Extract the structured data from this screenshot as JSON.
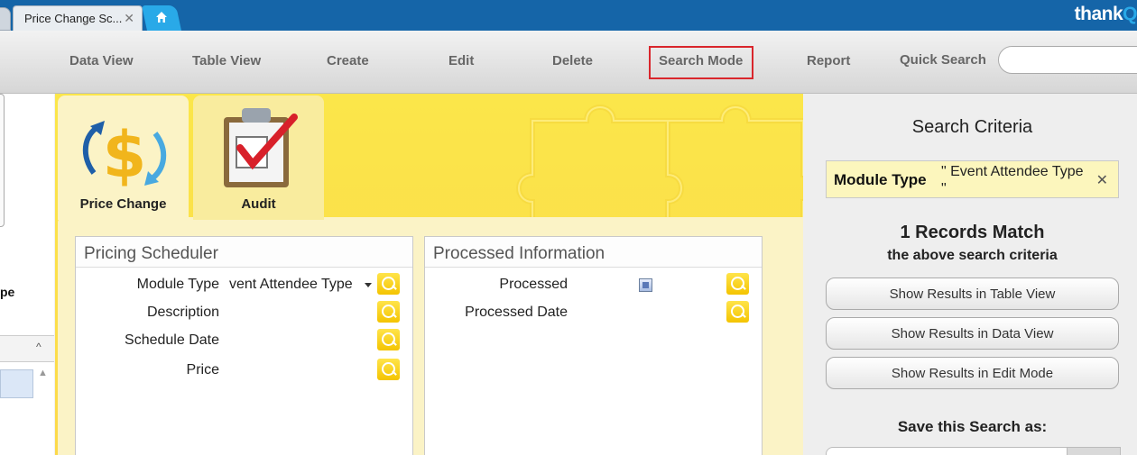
{
  "window": {
    "tab_title": "Price Change Sc...",
    "tab_close": "✕",
    "brand_main": "thank",
    "brand_accent": "Q"
  },
  "toolbar": {
    "data_view": "Data View",
    "table_view": "Table View",
    "create": "Create",
    "edit": "Edit",
    "delete": "Delete",
    "search_mode": "Search Mode",
    "report": "Report",
    "quick_search_label": "Quick Search",
    "quick_search_value": ""
  },
  "left_strip": {
    "partial_text": "pe",
    "up_arrow": "^",
    "up_arrow_small": "▲"
  },
  "icon_tabs": [
    {
      "label": "Price Change"
    },
    {
      "label": "Audit"
    }
  ],
  "pricing_panel": {
    "title": "Pricing Scheduler",
    "fields": [
      {
        "label": "Module Type",
        "value": "vent Attendee Type"
      },
      {
        "label": "Description",
        "value": ""
      },
      {
        "label": "Schedule Date",
        "value": ""
      },
      {
        "label": "Price",
        "value": ""
      }
    ]
  },
  "processed_panel": {
    "title": "Processed Information",
    "fields": [
      {
        "label": "Processed",
        "checked": true
      },
      {
        "label": "Processed Date",
        "value": ""
      }
    ]
  },
  "search_criteria": {
    "title": "Search Criteria",
    "criterion_key": "Module Type",
    "criterion_value": "\" Event Attendee Type \"",
    "remove": "✕",
    "match_count": "1 Records Match",
    "match_sub": "the above search criteria",
    "btn_table": "Show Results in Table View",
    "btn_data": "Show Results in Data View",
    "btn_edit": "Show Results in Edit Mode",
    "save_label": "Save this Search as:"
  },
  "colors": {
    "topbar": "#1565a8",
    "accent": "#29a9e8",
    "highlight_border": "#d9262c",
    "main_yellow": "#fbe64a",
    "search_button": "#f4c400"
  }
}
